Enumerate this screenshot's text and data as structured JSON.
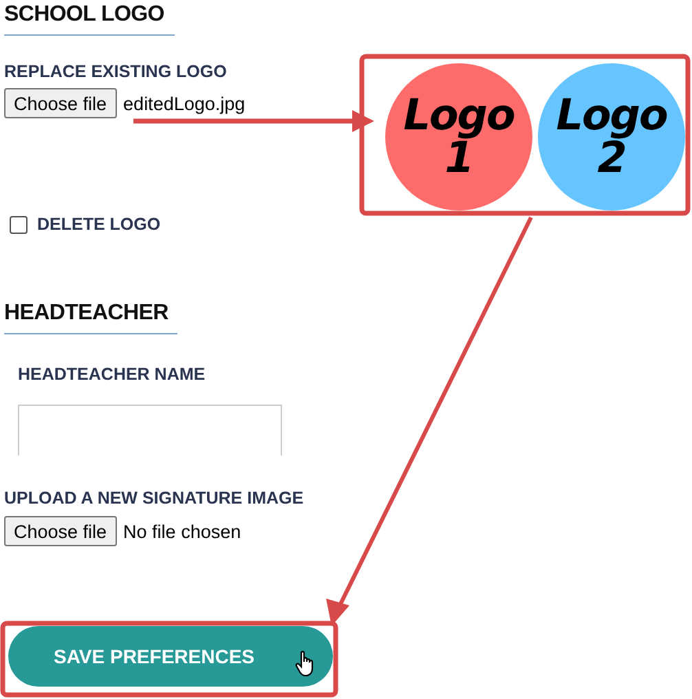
{
  "school_logo": {
    "heading": "SCHOOL LOGO",
    "replace_label": "REPLACE EXISTING LOGO",
    "file_button": "Choose file",
    "file_name": "editedLogo.jpg",
    "preview": [
      {
        "text": "Logo 1",
        "color": "#fe6b6b"
      },
      {
        "text": "Logo 2",
        "color": "#66c4fe"
      }
    ],
    "delete_logo": {
      "label": "DELETE LOGO",
      "checked": false
    }
  },
  "headteacher": {
    "heading": "HEADTEACHER",
    "name_label": "HEADTEACHER NAME",
    "signature_label": "UPLOAD A NEW SIGNATURE IMAGE",
    "file_button": "Choose file",
    "file_name": "No file chosen"
  },
  "save_button": "SAVE PREFERENCES"
}
